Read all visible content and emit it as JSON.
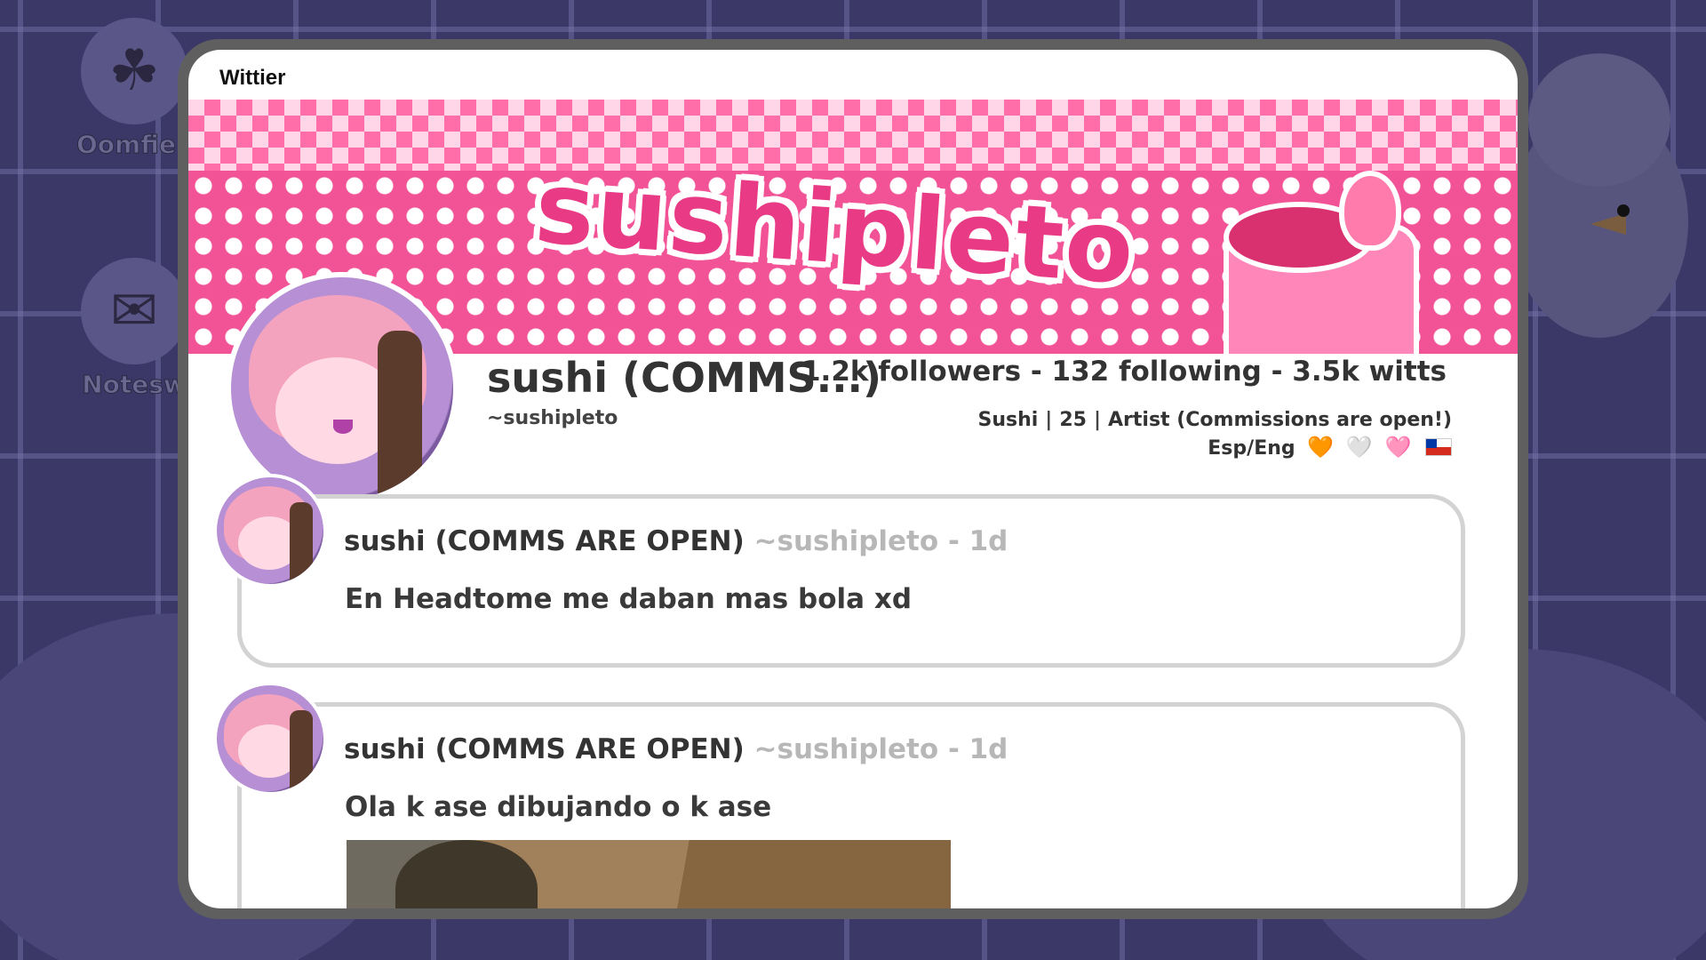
{
  "window": {
    "title": "Wittier"
  },
  "banner": {
    "title": "sushipleto"
  },
  "profile": {
    "display_name": "sushi (COMMS...)",
    "handle": "~sushipleto",
    "stats": "1.2k followers - 132 following - 3.5k witts",
    "bio_line1": {
      "name": "Sushi",
      "age": "25",
      "role": "Artist (Commissions are open!)"
    },
    "bio_line2": {
      "langs": "Esp/Eng",
      "heart1": "🧡",
      "heart2": "🤍",
      "heart3": "🩷",
      "flag": "chile-flag"
    }
  },
  "posts": [
    {
      "author": "sushi (COMMS ARE OPEN)",
      "meta": "~sushipleto - 1d",
      "text": "En Headtome me daban mas bola xd",
      "has_image": false
    },
    {
      "author": "sushi (COMMS ARE OPEN)",
      "meta": "~sushipleto - 1d",
      "text": "Ola k ase dibujando o k ase",
      "has_image": true
    }
  ],
  "desktop": {
    "icons": [
      {
        "label": "Oomfie l",
        "icon": "witch-avatar-icon"
      },
      {
        "label": "Notesw",
        "icon": "envelope-icon"
      }
    ]
  }
}
